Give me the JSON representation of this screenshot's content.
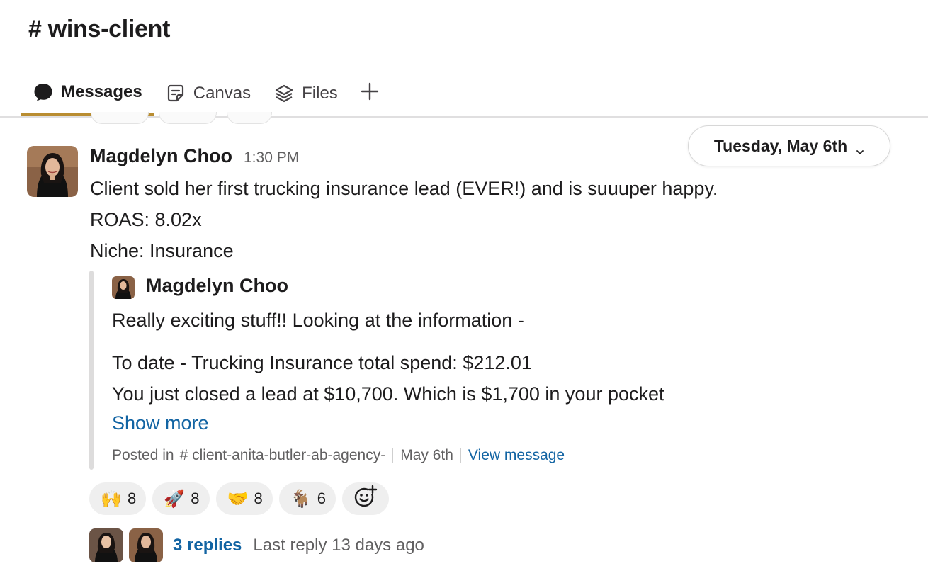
{
  "channel": {
    "hash": "#",
    "name": "wins-client"
  },
  "tabs": [
    {
      "label": "Messages",
      "icon": "chat-bubble-icon",
      "active": true
    },
    {
      "label": "Canvas",
      "icon": "canvas-icon",
      "active": false
    },
    {
      "label": "Files",
      "icon": "layers-icon",
      "active": false
    }
  ],
  "date_divider": {
    "label": "Tuesday, May 6th"
  },
  "message": {
    "author": "Magdelyn Choo",
    "time": "1:30 PM",
    "lines": [
      "Client sold her first trucking insurance lead (EVER!) and is suuuper happy.",
      "ROAS: 8.02x",
      "Niche: Insurance"
    ]
  },
  "shared_message": {
    "author": "Magdelyn Choo",
    "lines": [
      "Really exciting stuff!! Looking at the information -",
      "To date - Trucking Insurance total spend: $212.01",
      "You just closed a lead at $10,700. Which is $1,700 in your pocket"
    ],
    "show_more": "Show more",
    "posted_in_label": "Posted in",
    "channel": "# client-anita-butler-ab-agency-",
    "date": "May 6th",
    "view_message": "View message"
  },
  "reactions": [
    {
      "emoji": "raised-hands",
      "glyph": "🙌",
      "count": "8"
    },
    {
      "emoji": "rocket",
      "glyph": "🚀",
      "count": "8"
    },
    {
      "emoji": "handshake",
      "glyph": "🤝",
      "count": "8"
    },
    {
      "emoji": "goat",
      "glyph": "🐐",
      "count": "6"
    }
  ],
  "thread": {
    "replies": "3 replies",
    "last_reply": "Last reply 13 days ago"
  },
  "colors": {
    "accent_tab_underline": "#b98d31",
    "link": "#1264a3",
    "reaction_bg": "#efefef",
    "quote_bar": "#dddcdc"
  }
}
